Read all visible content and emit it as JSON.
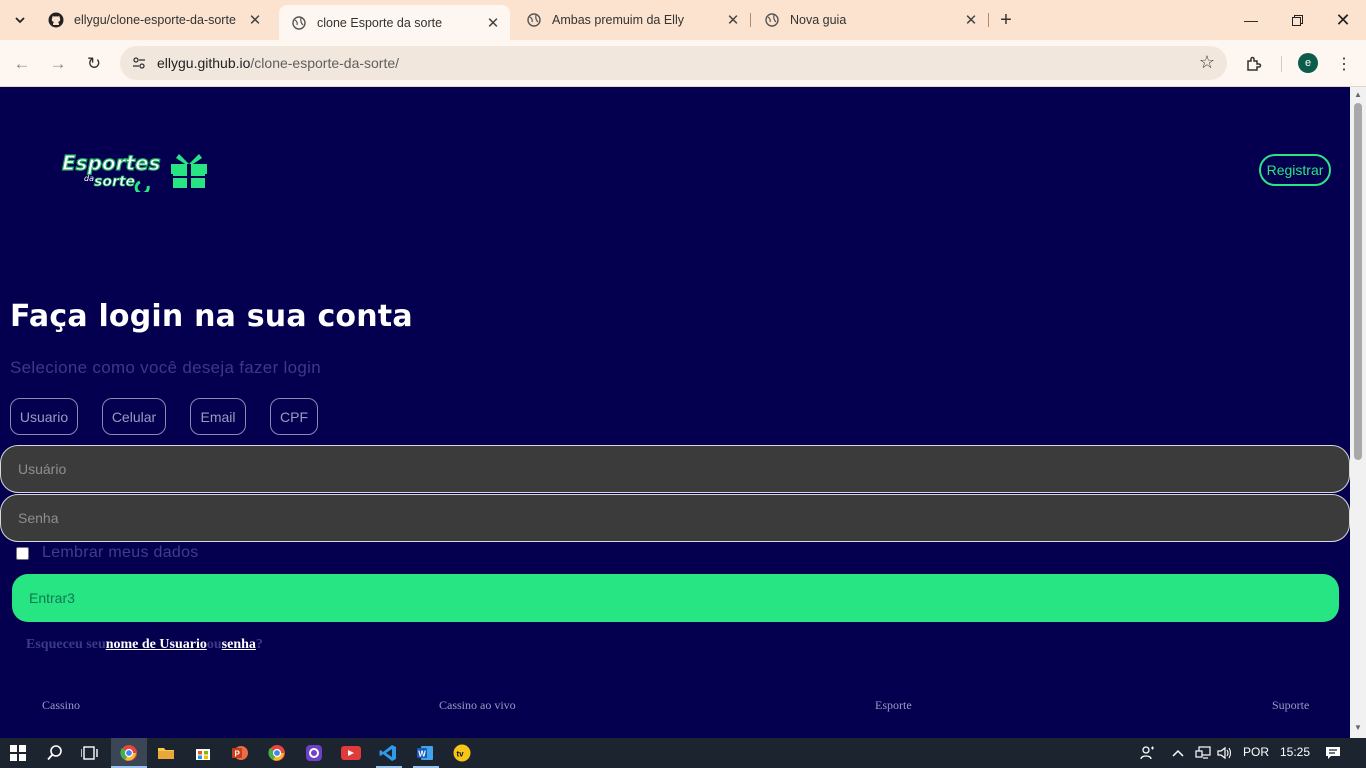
{
  "browser": {
    "tabs": [
      {
        "title": "ellygu/clone-esporte-da-sorte",
        "icon": "github-icon",
        "active": false
      },
      {
        "title": "clone Esporte da sorte",
        "icon": "globe-icon",
        "active": true
      },
      {
        "title": "Ambas premuim da Elly",
        "icon": "globe-icon",
        "active": false
      },
      {
        "title": "Nova guia",
        "icon": "globe-icon",
        "active": false
      }
    ],
    "url_host": "ellygu.github.io",
    "url_path": "/clone-esporte-da-sorte/",
    "profile_initial": "e"
  },
  "header": {
    "register_label": "Registrar"
  },
  "login": {
    "title": "Faça login na sua conta",
    "subtitle": "Selecione como você deseja fazer login",
    "methods": [
      "Usuario",
      "Celular",
      "Email",
      "CPF"
    ],
    "username_placeholder": "Usuário",
    "password_placeholder": "Senha",
    "remember_label": "Lembrar meus dados",
    "remember_checked": false,
    "submit_label": "Entrar3",
    "forgot_prefix": "Esqueceu seu",
    "forgot_username_link": "nome de Usuario",
    "forgot_or": "ou",
    "forgot_password_link": "senha",
    "forgot_suffix": "?"
  },
  "footer": {
    "links": [
      "Cassino",
      "Cassino ao vivo",
      "Esporte",
      "Suporte"
    ]
  },
  "taskbar": {
    "language": "POR",
    "time": "15:25"
  },
  "colors": {
    "page_bg": "#04004f",
    "accent_green": "#28e584",
    "input_bg": "#3b3b3b",
    "tabstrip_bg": "#fbe3cf"
  }
}
